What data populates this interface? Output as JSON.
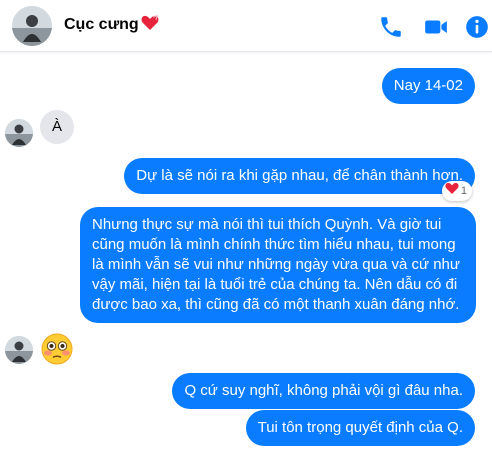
{
  "header": {
    "contact_name": "Cục cưng",
    "icons": {
      "name_emoji": "heart-emoji",
      "call": "phone-icon",
      "video": "video-camera-icon",
      "info": "info-icon"
    },
    "accent_color": "#0a7cff"
  },
  "messages": [
    {
      "side": "out",
      "text": "Nay 14-02"
    },
    {
      "side": "in",
      "text": "À"
    },
    {
      "side": "out",
      "text": "Dự là sẽ nói ra khi gặp nhau, để chân thành hơn.",
      "reaction": {
        "emoji": "red-heart",
        "count": "1"
      }
    },
    {
      "side": "out",
      "lines": [
        "Nhưng thực sự mà nói thì tui thích Quỳnh. Và giờ tui",
        "cũng muốn là mình chính thức tìm hiểu nhau, tui mong",
        "là mình vẫn sẽ vui như những ngày vừa qua và cứ như",
        "vậy mãi, hiện tại là tuổi trẻ của chúng ta. Nên dẫu có đi",
        "được bao xa, thì cũng đã có một thanh xuân đáng nhớ."
      ]
    },
    {
      "side": "in",
      "emoji": "flushed-face-emoji"
    },
    {
      "side": "out",
      "text": "Q cứ suy nghĩ, không phải vội gì đâu nha."
    },
    {
      "side": "out",
      "text": "Tui tôn trọng quyết định của Q."
    }
  ]
}
